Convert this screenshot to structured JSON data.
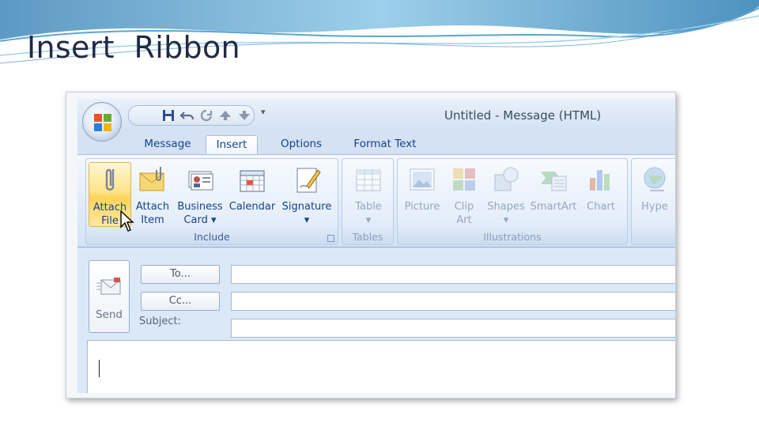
{
  "slide": {
    "title": "Insert  Ribbon"
  },
  "window": {
    "title": "Untitled - Message (HTML)"
  },
  "quick_access": {
    "buttons": [
      "save-icon",
      "undo-icon",
      "redo-icon",
      "previous-item-icon",
      "next-item-icon"
    ],
    "dropdown": "▾"
  },
  "tabs": [
    {
      "label": "Message",
      "active": false
    },
    {
      "label": "Insert",
      "active": true
    },
    {
      "label": "Options",
      "active": false
    },
    {
      "label": "Format Text",
      "active": false
    }
  ],
  "ribbon": {
    "include": {
      "label": "Include",
      "buttons": [
        {
          "label": "Attach\nFile",
          "icon": "paperclip-icon",
          "enabled": true,
          "hover": true
        },
        {
          "label": "Attach\nItem",
          "icon": "envelope-clip-icon",
          "enabled": true
        },
        {
          "label": "Business\nCard ▾",
          "icon": "business-card-icon",
          "enabled": true
        },
        {
          "label": "Calendar",
          "icon": "calendar-icon",
          "enabled": true
        },
        {
          "label": "Signature\n▾",
          "icon": "signature-icon",
          "enabled": true
        }
      ]
    },
    "tables": {
      "label": "Tables",
      "buttons": [
        {
          "label": "Table\n▾",
          "icon": "table-icon",
          "enabled": false
        }
      ]
    },
    "illustrations": {
      "label": "Illustrations",
      "buttons": [
        {
          "label": "Picture",
          "icon": "picture-icon",
          "enabled": false
        },
        {
          "label": "Clip\nArt",
          "icon": "clip-art-icon",
          "enabled": false
        },
        {
          "label": "Shapes\n▾",
          "icon": "shapes-icon",
          "enabled": false
        },
        {
          "label": "SmartArt",
          "icon": "smartart-icon",
          "enabled": false
        },
        {
          "label": "Chart",
          "icon": "chart-icon",
          "enabled": false
        }
      ]
    },
    "links": {
      "buttons": [
        {
          "label": "Hype",
          "icon": "hyperlink-globe-icon",
          "enabled": false
        }
      ]
    }
  },
  "form": {
    "send_label": "Send",
    "to_label": "To...",
    "cc_label": "Cc...",
    "subject_label": "Subject:",
    "to_value": "",
    "cc_value": "",
    "subject_value": ""
  },
  "colors": {
    "ribbon_text": "#15428b",
    "disabled_text": "#94a7c0",
    "hover_gradient": "#ffe48a"
  }
}
